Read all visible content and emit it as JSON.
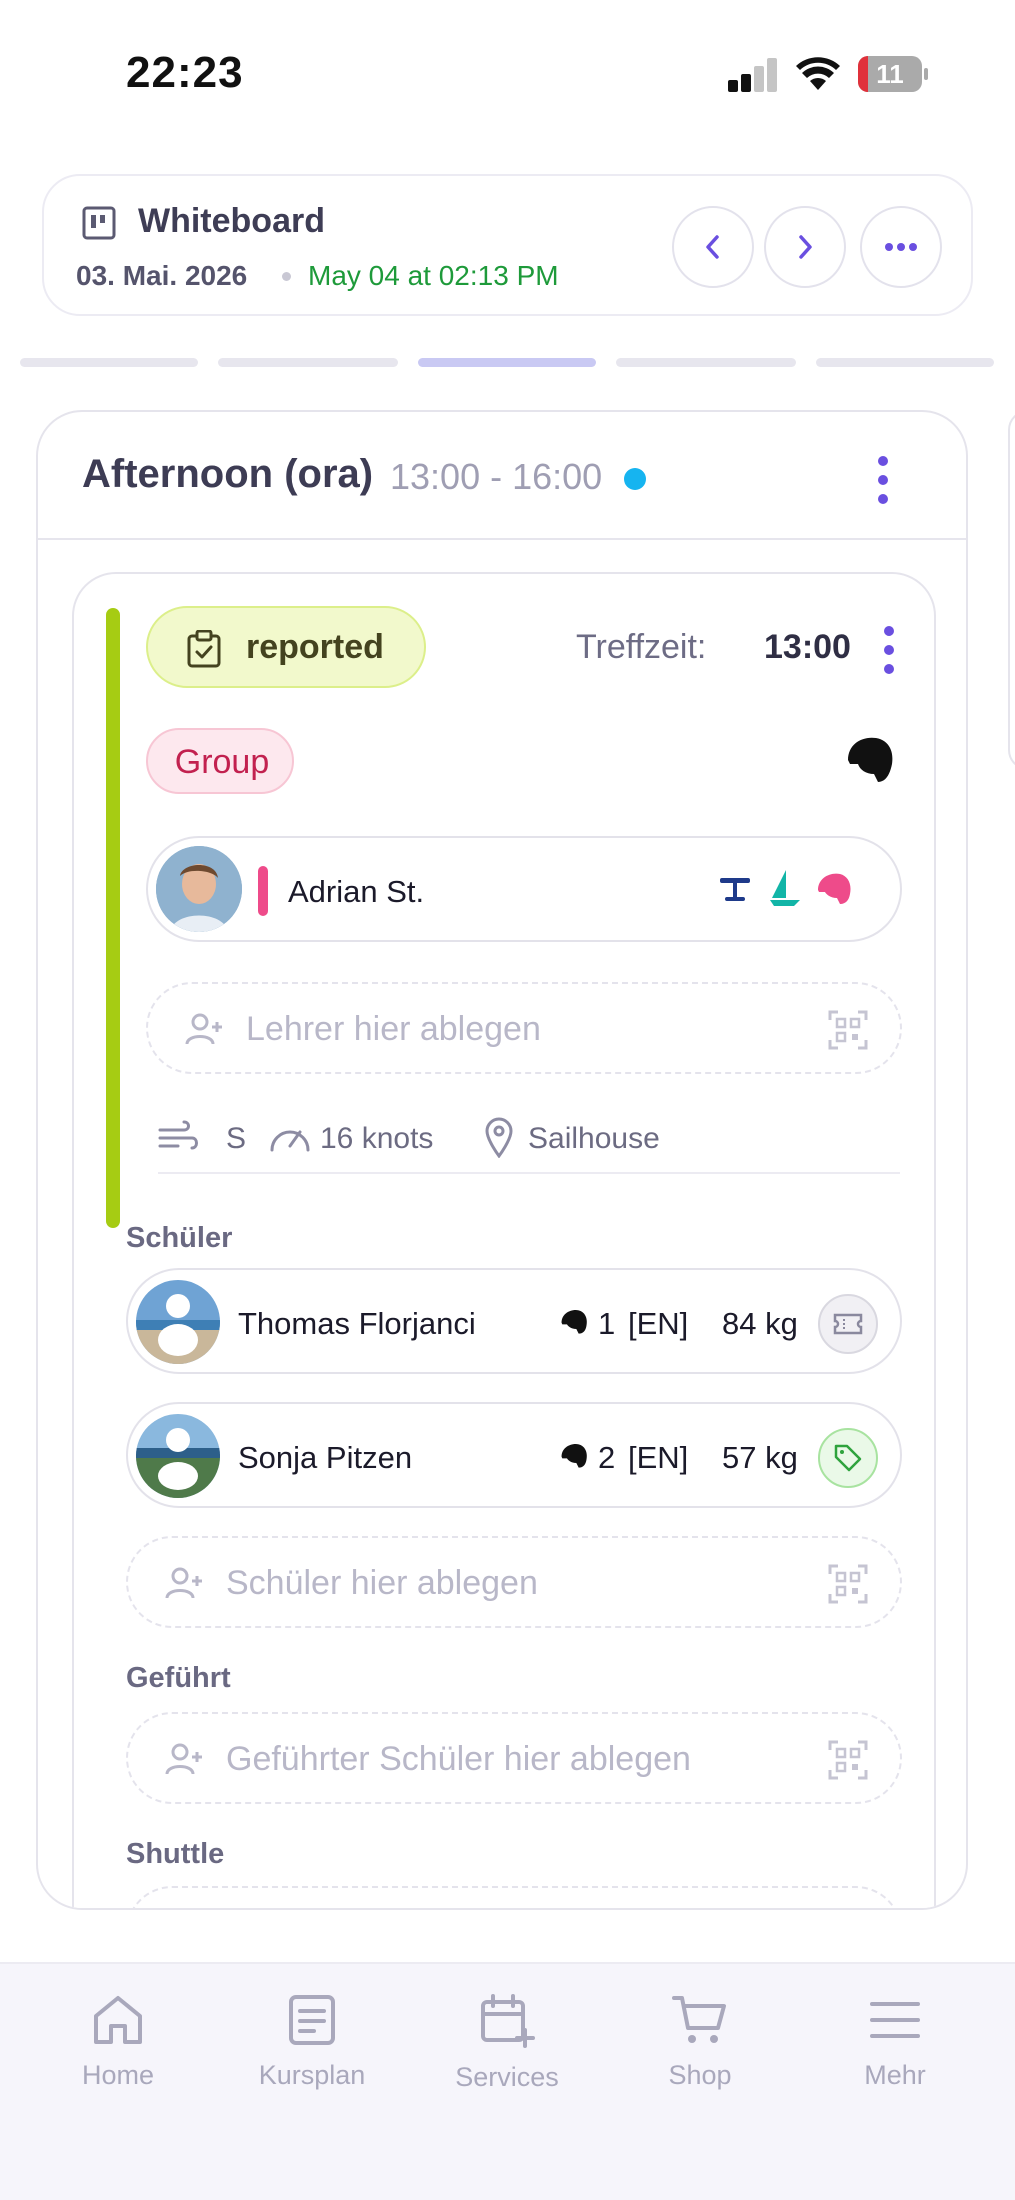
{
  "status_bar": {
    "time": "22:23",
    "battery": "11"
  },
  "header": {
    "title": "Whiteboard",
    "date": "03. Mai. 2026",
    "updated": "May 04 at 02:13 PM"
  },
  "slot": {
    "title": "Afternoon (ora)",
    "time_range": "13:00 - 16:00",
    "status_color": "#16b4f0"
  },
  "lesson": {
    "status": "reported",
    "meeting_label": "Treffzeit:",
    "meeting_time": "13:00",
    "type": "Group",
    "accent_color": "#a6cc13",
    "teacher": {
      "name": "Adrian St.",
      "icons": [
        "hydrofoil-icon",
        "sail-icon",
        "helmet-icon"
      ]
    },
    "teacher_drop_placeholder": "Lehrer hier ablegen",
    "conditions": {
      "wind_direction": "S",
      "wind_speed": "16 knots",
      "location": "Sailhouse"
    },
    "students_label": "Schüler",
    "students": [
      {
        "name": "Thomas Florjanci",
        "level": "1",
        "lang": "[EN]",
        "weight": "84 kg",
        "action_icon": "ticket-icon"
      },
      {
        "name": "Sonja Pitzen",
        "level": "2",
        "lang": "[EN]",
        "weight": "57 kg",
        "action_icon": "tag-icon"
      }
    ],
    "students_drop_placeholder": "Schüler hier ablegen",
    "guided_label": "Geführt",
    "guided_drop_placeholder": "Geführter Schüler hier ablegen",
    "shuttle_label": "Shuttle"
  },
  "tabbar": {
    "items": [
      {
        "label": "Home",
        "icon": "home-icon"
      },
      {
        "label": "Kursplan",
        "icon": "document-icon"
      },
      {
        "label": "Services",
        "icon": "calendar-plus-icon"
      },
      {
        "label": "Shop",
        "icon": "cart-icon"
      },
      {
        "label": "Mehr",
        "icon": "menu-icon"
      }
    ]
  },
  "colors": {
    "accent": "#6a4fe0",
    "success": "#1e9a3a",
    "group": "#c2214f"
  }
}
